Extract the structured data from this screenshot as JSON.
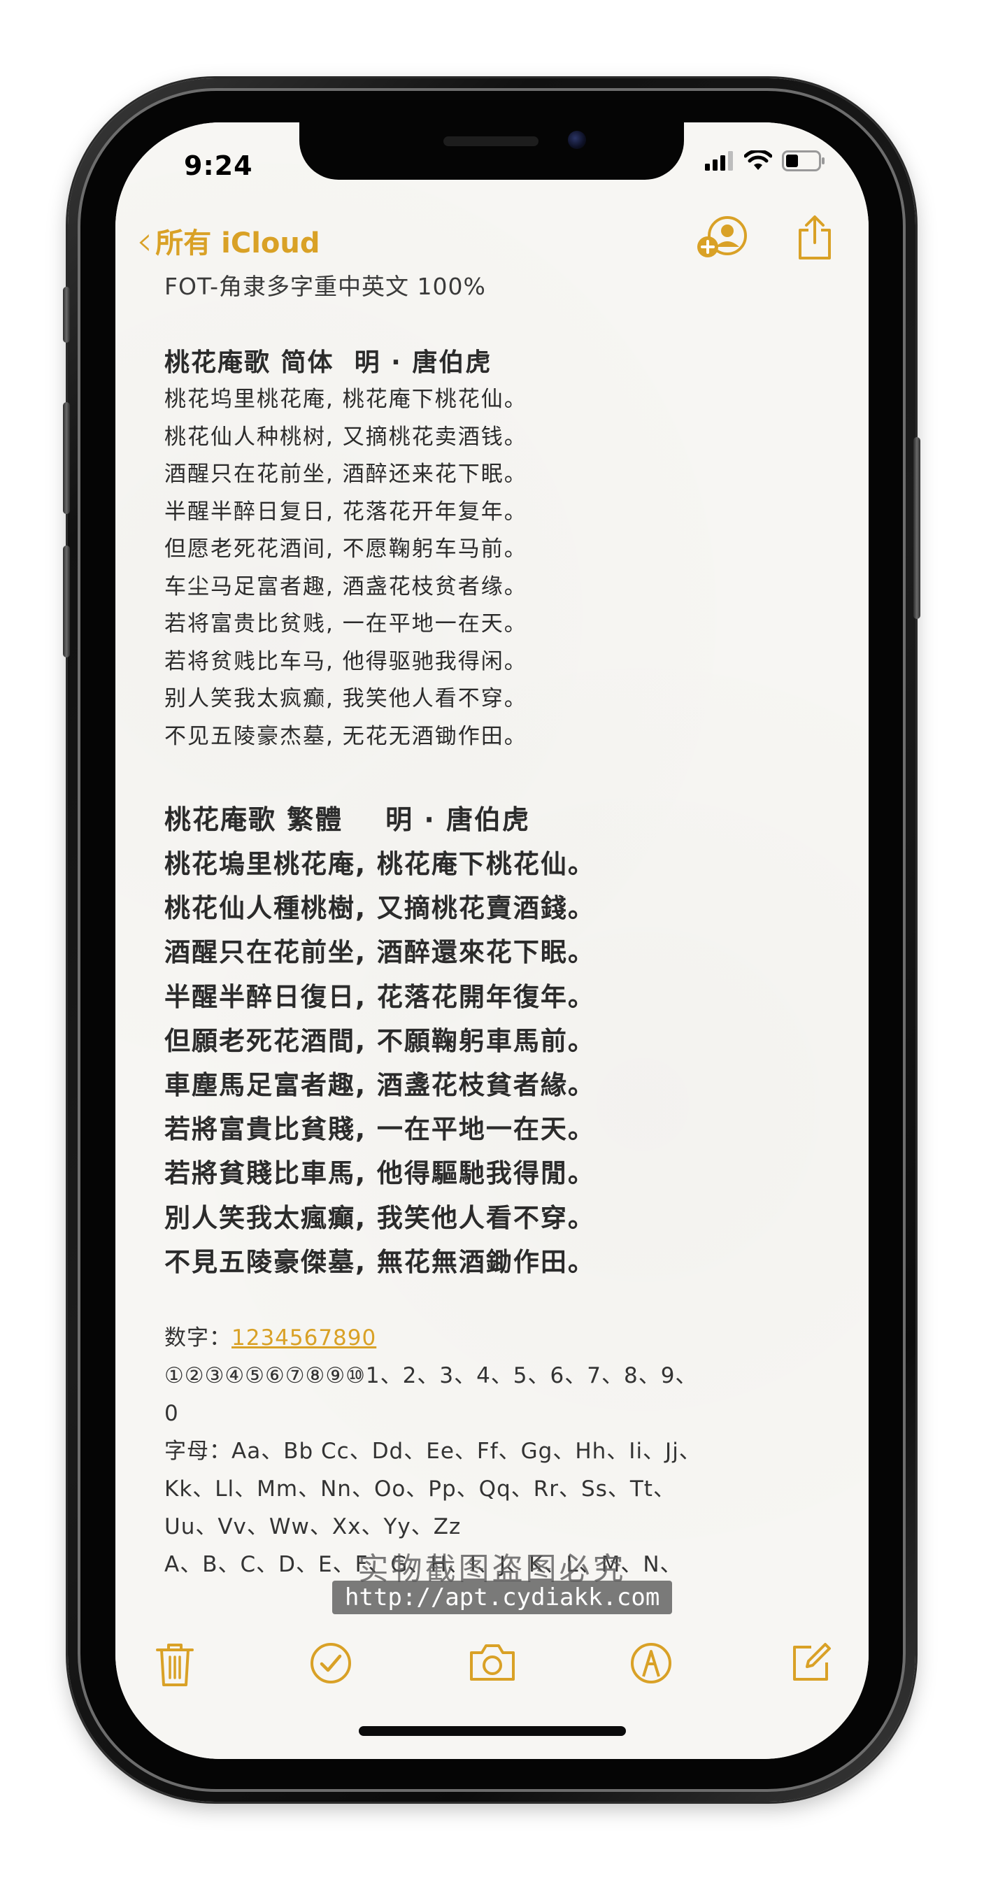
{
  "status": {
    "time": "9:24"
  },
  "nav": {
    "back_label": "所有 iCloud",
    "collab_icon": "person-add-icon",
    "share_icon": "share-icon"
  },
  "note": {
    "title_line": "FOT-角隶多字重中英文 100%",
    "poem_simplified": {
      "heading": "桃花庵歌 简体  明 · 唐伯虎",
      "lines": [
        "桃花坞里桃花庵, 桃花庵下桃花仙。",
        "桃花仙人种桃树, 又摘桃花卖酒钱。",
        "酒醒只在花前坐, 酒醉还来花下眠。",
        "半醒半醉日复日, 花落花开年复年。",
        "但愿老死花酒间, 不愿鞠躬车马前。",
        "车尘马足富者趣, 酒盏花枝贫者缘。",
        "若将富贵比贫贱, 一在平地一在天。",
        "若将贫贱比车马, 他得驱驰我得闲。",
        "别人笑我太疯癫, 我笑他人看不穿。",
        "不见五陵豪杰墓, 无花无酒锄作田。"
      ]
    },
    "poem_traditional": {
      "heading": "桃花庵歌 繁體    明 · 唐伯虎",
      "lines": [
        "桃花塢里桃花庵, 桃花庵下桃花仙。",
        "桃花仙人種桃樹, 又摘桃花賣酒錢。",
        "酒醒只在花前坐, 酒醉還來花下眠。",
        "半醒半醉日復日, 花落花開年復年。",
        "但願老死花酒間, 不願鞠躬車馬前。",
        "車塵馬足富者趣, 酒盞花枝貧者緣。",
        "若將富貴比貧賤, 一在平地一在天。",
        "若將貧賤比車馬, 他得驅馳我得閒。",
        "別人笑我太瘋癲, 我笑他人看不穿。",
        "不見五陵豪傑墓, 無花無酒鋤作田。"
      ]
    },
    "numbers_label": "数字：",
    "numbers_link": "1234567890",
    "circled_numbers_line": "①②③④⑤⑥⑦⑧⑨⑩1、2、3、4、5、6、7、8、9、",
    "circled_numbers_line2": "0",
    "letters_line1": "字母：Aa、Bb Cc、Dd、Ee、Ff、Gg、Hh、Ii、Jj、",
    "letters_line2": "Kk、Ll、Mm、Nn、Oo、Pp、Qq、Rr、Ss、Tt、",
    "letters_line3": "Uu、Vv、Ww、Xx、Yy、Zz",
    "letters_line4": "A、B、C、D、E、F、G、H、I、J、K、L、M、N、"
  },
  "watermark": {
    "text": "实物截图盗图必究",
    "url": "http://apt.cydiakk.com"
  },
  "toolbar": {
    "icons": [
      "trash-icon",
      "checklist-icon",
      "camera-icon",
      "markup-icon",
      "compose-icon"
    ]
  },
  "colors": {
    "accent": "#d9a126",
    "paper": "#f7f6f3",
    "text": "#2b2b2b"
  }
}
